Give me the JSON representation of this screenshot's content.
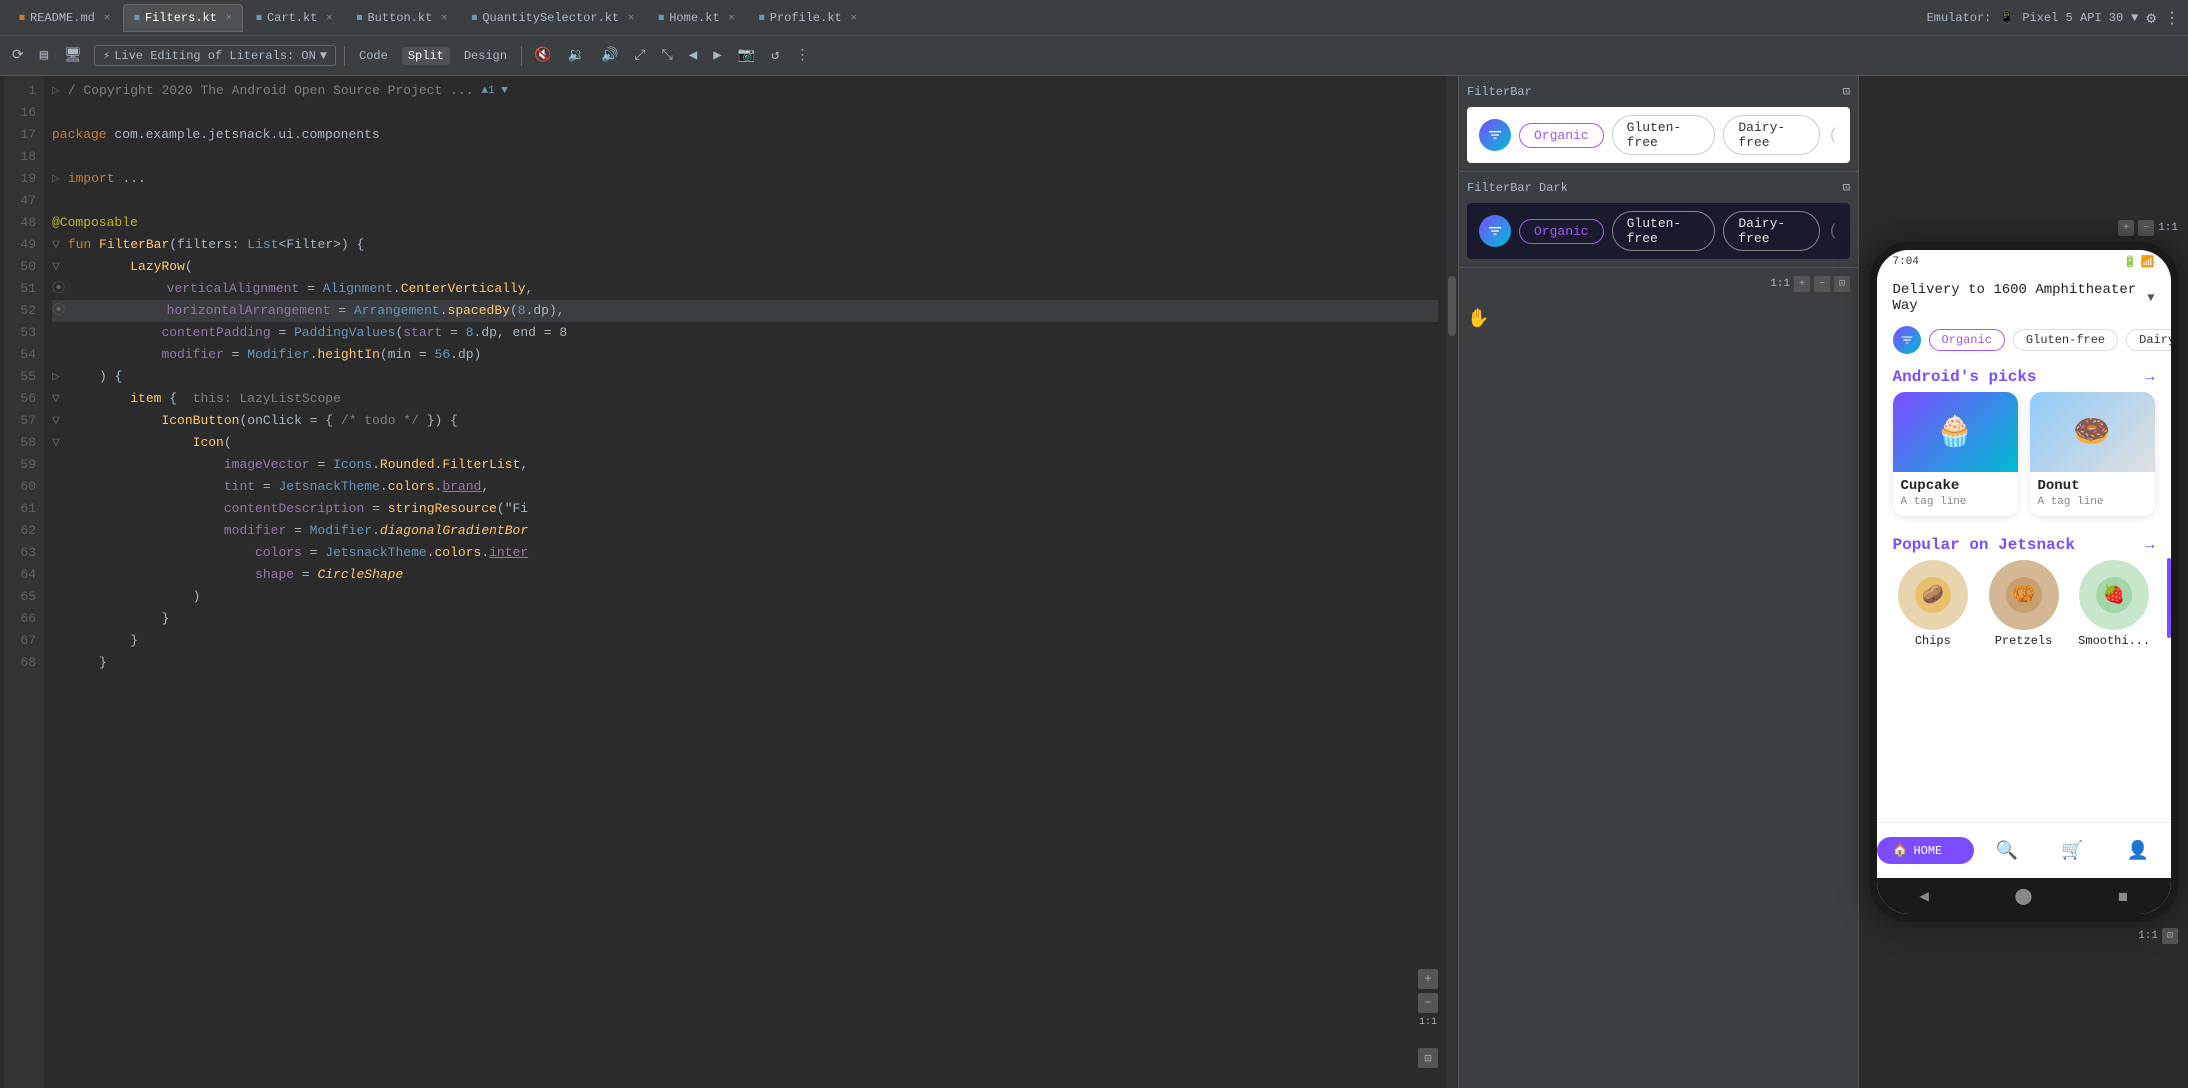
{
  "window": {
    "title": "Android Studio"
  },
  "tabs": [
    {
      "label": "README.md",
      "type": "md",
      "active": false
    },
    {
      "label": "Filters.kt",
      "type": "kt",
      "active": true
    },
    {
      "label": "Cart.kt",
      "type": "kt",
      "active": false
    },
    {
      "label": "Button.kt",
      "type": "kt",
      "active": false
    },
    {
      "label": "QuantitySelector.kt",
      "type": "kt",
      "active": false
    },
    {
      "label": "Home.kt",
      "type": "kt",
      "active": false
    },
    {
      "label": "Profile.kt",
      "type": "kt",
      "active": false
    }
  ],
  "toolbar": {
    "live_editing_label": "Live Editing of Literals: ON",
    "code_label": "Code",
    "split_label": "Split",
    "design_label": "Design"
  },
  "emulator": {
    "label": "Emulator:",
    "device": "Pixel 5 API 30"
  },
  "code": {
    "lines": [
      {
        "num": 1,
        "content": "/ Copyright 2020 The Android Open Source Project ...",
        "type": "comment"
      },
      {
        "num": 16,
        "content": "",
        "type": "plain"
      },
      {
        "num": 17,
        "content": "package com.example.jetsnack.ui.components",
        "type": "package"
      },
      {
        "num": 18,
        "content": "",
        "type": "plain"
      },
      {
        "num": 19,
        "content": "import ...",
        "type": "import"
      },
      {
        "num": 47,
        "content": "",
        "type": "plain"
      },
      {
        "num": 48,
        "content": "@Composable",
        "type": "annotation"
      },
      {
        "num": 49,
        "content": "fun FilterBar(filters: List<Filter>) {",
        "type": "function"
      },
      {
        "num": 50,
        "content": "    LazyRow(",
        "type": "code"
      },
      {
        "num": 51,
        "content": "        verticalAlignment = Alignment.CenterVertically,",
        "type": "code"
      },
      {
        "num": 52,
        "content": "        horizontalArrangement = Arrangement.spacedBy(8.dp),",
        "type": "code",
        "highlighted": true
      },
      {
        "num": 53,
        "content": "        contentPadding = PaddingValues(start = 8.dp, end = 8",
        "type": "code"
      },
      {
        "num": 54,
        "content": "        modifier = Modifier.heightIn(min = 56.dp)",
        "type": "code"
      },
      {
        "num": 55,
        "content": "    ) {",
        "type": "code"
      },
      {
        "num": 56,
        "content": "        item {  this: LazyListScope",
        "type": "code"
      },
      {
        "num": 57,
        "content": "            IconButton(onClick = { /* todo */ }) {",
        "type": "code"
      },
      {
        "num": 58,
        "content": "                Icon(",
        "type": "code"
      },
      {
        "num": 59,
        "content": "                    imageVector = Icons.Rounded.FilterList,",
        "type": "code"
      },
      {
        "num": 60,
        "content": "                    tint = JetsnackTheme.colors.brand,",
        "type": "code"
      },
      {
        "num": 61,
        "content": "                    contentDescription = stringResource(\"Fi",
        "type": "code"
      },
      {
        "num": 62,
        "content": "                    modifier = Modifier.diagonalGradientBor",
        "type": "code"
      },
      {
        "num": 63,
        "content": "                        colors = JetsnackTheme.colors.inter",
        "type": "code"
      },
      {
        "num": 64,
        "content": "                        shape = CircleShape",
        "type": "code"
      },
      {
        "num": 65,
        "content": "                )",
        "type": "code"
      },
      {
        "num": 66,
        "content": "            }",
        "type": "code"
      },
      {
        "num": 67,
        "content": "        }",
        "type": "code"
      },
      {
        "num": 68,
        "content": "    }",
        "type": "code"
      }
    ]
  },
  "preview": {
    "filterbar_light_title": "FilterBar",
    "filterbar_dark_title": "FilterBar Dark",
    "chips_light": [
      "Organic",
      "Gluten-free",
      "Dairy-free"
    ],
    "chips_dark": [
      "Organic",
      "Gluten-free",
      "Dairy-free"
    ]
  },
  "phone": {
    "time": "7:04",
    "delivery_text": "Delivery to 1600 Amphitheater Way",
    "filters": [
      "Organic",
      "Gluten-free",
      "Dairy-free"
    ],
    "androids_picks_title": "Android's picks",
    "popular_title": "Popular on Jetsnack",
    "cards": [
      {
        "name": "Cupcake",
        "subtitle": "A tag line",
        "emoji": "🧁"
      },
      {
        "name": "Donut",
        "subtitle": "A tag line",
        "emoji": "🍩"
      }
    ],
    "popular_items": [
      {
        "name": "Chips",
        "emoji": "🥔"
      },
      {
        "name": "Pretzels",
        "emoji": "🥨"
      },
      {
        "name": "Smoothi...",
        "emoji": "🍓"
      }
    ],
    "nav_items": [
      "HOME",
      "🔍",
      "🛒",
      "👤"
    ],
    "home_label": "HOME"
  }
}
